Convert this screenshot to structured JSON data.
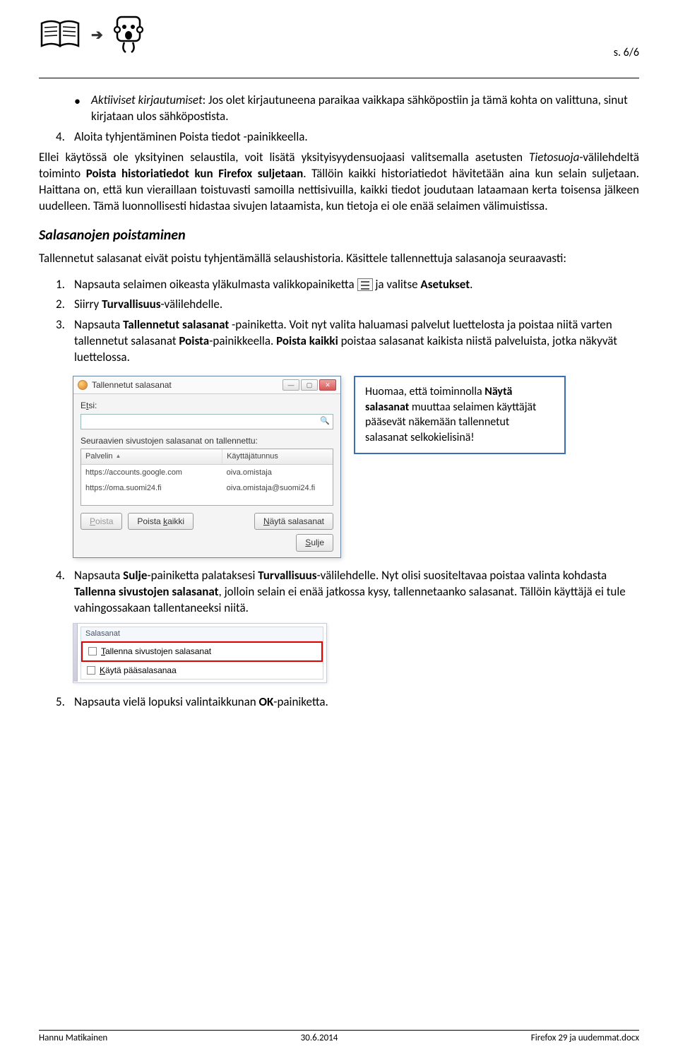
{
  "header": {
    "page_number": "s. 6/6"
  },
  "bullet_item": {
    "lead": "Aktiiviset kirjautumiset",
    "rest": ": Jos olet kirjautuneena paraikaa vaikkapa sähköpostiin ja tämä kohta on valittuna, sinut kirjataan ulos sähköpostista."
  },
  "list1": {
    "n4": {
      "num": "4.",
      "text": "Aloita tyhjentäminen Poista tiedot -painikkeella."
    }
  },
  "para1": {
    "text_a": "Ellei käytössä ole yksityinen selaustila, voit lisätä yksityisyydensuojaasi valitsemalla asetusten ",
    "i1": "Tietosuoja",
    "text_b": "-välilehdeltä toiminto ",
    "b1": "Poista historiatiedot kun Firefox suljetaan",
    "text_c": ". Tällöin kaikki historiatiedot hävitetään aina kun selain suljetaan. Haittana on, että kun vieraillaan toistuvasti samoilla nettisivuilla, kaikki tiedot joudutaan lataamaan kerta toisensa jälkeen uudelleen. Tämä luonnollisesti hidastaa sivujen lataamista, kun tietoja ei ole enää selaimen välimuistissa."
  },
  "h2": "Salasanojen poistaminen",
  "para2": "Tallennetut salasanat eivät poistu tyhjentämällä selaushistoria. Käsittele tallennettuja salasanoja seuraavasti:",
  "list2": {
    "n1": {
      "num": "1.",
      "pre": "Napsauta selaimen oikeasta yläkulmasta valikkopainiketta ",
      "post": " ja valitse ",
      "b": "Asetukset",
      "end": "."
    },
    "n2": {
      "num": "2.",
      "a": "Siirry ",
      "b": "Turvallisuus",
      "c": "-välilehdelle."
    },
    "n3": {
      "num": "3.",
      "a": "Napsauta ",
      "b": "Tallennetut salasanat",
      "c": " -painiketta. Voit nyt valita haluamasi palvelut luettelosta ja poistaa niitä varten tallennetut salasanat ",
      "d": "Poista",
      "e": "-painikkeella. ",
      "f": "Poista kaikki",
      "g": " poistaa salasanat kaikista niistä palveluista, jotka näkyvät luettelossa."
    },
    "n4": {
      "num": "4.",
      "a": "Napsauta ",
      "b": "Sulje",
      "c": "-painiketta palataksesi ",
      "d": "Turvallisuus",
      "e": "-välilehdelle. Nyt olisi suositeltavaa poistaa valinta kohdasta ",
      "f": "Tallenna sivustojen salasanat",
      "g": ", jolloin selain ei enää jatkossa kysy, tallennetaanko salasanat. Tällöin käyttäjä ei tule vahingossakaan tallentaneeksi niitä."
    },
    "n5": {
      "num": "5.",
      "a": "Napsauta vielä lopuksi valintaikkunan ",
      "b": "OK",
      "c": "-painiketta."
    }
  },
  "dialog": {
    "title": "Tallennetut salasanat",
    "search_label_pre": "E",
    "search_label_u": "t",
    "search_label_post": "si:",
    "search_placeholder": "",
    "caption": "Seuraavien sivustojen salasanat on tallennettu:",
    "col1": "Palvelin",
    "col2": "Käyttäjätunnus",
    "rows": [
      {
        "server": "https://accounts.google.com",
        "user": "oiva.omistaja"
      },
      {
        "server": "https://oma.suomi24.fi",
        "user": "oiva.omistaja@suomi24.fi"
      }
    ],
    "btn_remove_pre": "",
    "btn_remove_u": "P",
    "btn_remove_post": "oista",
    "btn_remove_all_pre": "Poista ",
    "btn_remove_all_u": "k",
    "btn_remove_all_post": "aikki",
    "btn_show_pre": "",
    "btn_show_u": "N",
    "btn_show_post": "äytä salasanat",
    "btn_close_pre": "",
    "btn_close_u": "S",
    "btn_close_post": "ulje"
  },
  "callout": {
    "a": "Huomaa, että toiminnolla ",
    "b": "Näytä salasanat",
    "c": " muuttaa selaimen käyttäjät pääsevät näkemään tallennetut salasanat selkokielisinä!"
  },
  "settings": {
    "group_title": "Salasanat",
    "opt1_u": "T",
    "opt1_rest": "allenna sivustojen salasanat",
    "opt2_pre": "",
    "opt2_u": "K",
    "opt2_rest": "äytä pääsalasanaa"
  },
  "footer": {
    "left": "Hannu Matikainen",
    "center": "30.6.2014",
    "right": "Firefox 29 ja uudemmat.docx"
  }
}
